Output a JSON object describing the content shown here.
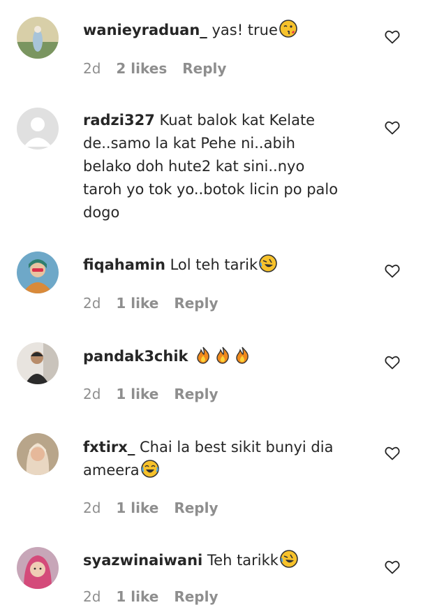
{
  "comments": [
    {
      "username": "wanieyraduan_",
      "text": " yas! true",
      "emoji": "winking-kiss-emoji",
      "time": "2d",
      "likes": "2 likes",
      "reply": "Reply",
      "avatar_colors": [
        "#d8cfa8",
        "#7a9560"
      ]
    },
    {
      "username": "radzi327",
      "text": " Kuat balok kat Kelate de..samo la kat Pehe ni..abih belako doh hute2 kat sini..nyo taroh yo tok yo..botok licin po palo dogo",
      "emoji": "",
      "time": "",
      "likes": "",
      "reply": "",
      "avatar_colors": [
        "#e0e0e0",
        "#ffffff"
      ]
    },
    {
      "username": "fiqahamin",
      "text": " Lol teh tarik",
      "emoji": "rofl-emoji",
      "time": "2d",
      "likes": "1 like",
      "reply": "Reply",
      "avatar_colors": [
        "#6ea8c8",
        "#d98a3a"
      ]
    },
    {
      "username": "pandak3chik",
      "text": " ",
      "emoji": "fire-emoji-x3",
      "time": "2d",
      "likes": "1 like",
      "reply": "Reply",
      "avatar_colors": [
        "#e8e4df",
        "#2b2b2b"
      ]
    },
    {
      "username": "fxtirx_",
      "text": " Chai la best sikit bunyi dia ameera",
      "emoji": "laughing-tears-emoji",
      "time": "2d",
      "likes": "1 like",
      "reply": "Reply",
      "avatar_colors": [
        "#b8a58a",
        "#e9d7c2"
      ]
    },
    {
      "username": "syazwinaiwani",
      "text": " Teh tarikk",
      "emoji": "rofl-emoji",
      "time": "2d",
      "likes": "1 like",
      "reply": "Reply",
      "avatar_colors": [
        "#c7a6b8",
        "#d44a7a"
      ]
    }
  ],
  "icons": {
    "heart": "heart-outline-icon"
  }
}
